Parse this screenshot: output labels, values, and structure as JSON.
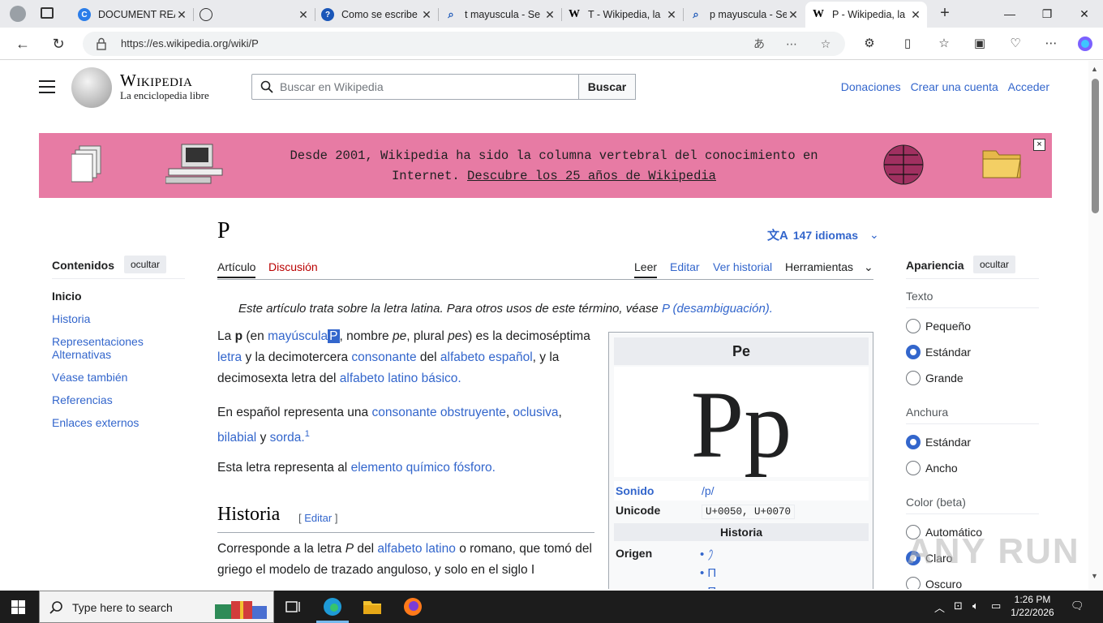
{
  "browser": {
    "tabs": [
      {
        "title": "DOCUMENT READ",
        "icon": "copilot-icon"
      },
      {
        "title": "",
        "icon": "globe-icon"
      },
      {
        "title": "Como se escribe",
        "icon": "question-icon"
      },
      {
        "title": "t mayuscula - Se",
        "icon": "search-icon"
      },
      {
        "title": "T - Wikipedia, la",
        "icon": "wikipedia-icon"
      },
      {
        "title": "p mayuscula - Se",
        "icon": "search-icon"
      },
      {
        "title": "P - Wikipedia, la",
        "icon": "wikipedia-icon"
      }
    ],
    "new_tab": "+",
    "url": "https://es.wikipedia.org/wiki/P"
  },
  "header": {
    "wordmark": "Wikipedia",
    "tagline": "La enciclopedia libre",
    "search_placeholder": "Buscar en Wikipedia",
    "search_button": "Buscar",
    "links": [
      "Donaciones",
      "Crear una cuenta",
      "Acceder"
    ]
  },
  "banner": {
    "line1": "Desde 2001, Wikipedia ha sido la columna vertebral del conocimiento en",
    "line2_prefix": "Internet.",
    "line2_link": "Descubre los 25 años de Wikipedia",
    "close": "×"
  },
  "toc": {
    "title": "Contenidos",
    "hide": "ocultar",
    "items": [
      "Inicio",
      "Historia",
      "Representaciones Alternativas",
      "Véase también",
      "Referencias",
      "Enlaces externos"
    ]
  },
  "article": {
    "title": "P",
    "languages": "147 idiomas",
    "tabs": {
      "article": "Artículo",
      "talk": "Discusión",
      "read": "Leer",
      "edit": "Editar",
      "history": "Ver historial",
      "tools": "Herramientas"
    },
    "hatnote_text": "Este artículo trata sobre la letra latina. Para otros usos de este término, véase",
    "hatnote_link": "P (desambiguación).",
    "p1": {
      "a": "La",
      "b": "p",
      "c": "(en",
      "d": "mayúscula",
      "e": "P",
      "f": ", nombre",
      "g": "pe",
      "h": ", plural",
      "i": "pes",
      "j": ") es la decimoséptima",
      "k": "letra",
      "l": "y la decimotercera",
      "m": "consonante",
      "n": "del",
      "o": "alfabeto español",
      "p": ", y la decimosexta letra del",
      "q": "alfabeto latino básico."
    },
    "p2": {
      "a": "En español representa una",
      "b": "consonante obstruyente",
      "c": ",",
      "d": "oclusiva",
      "e": ",",
      "f": "bilabial",
      "g": "y",
      "h": "sorda.",
      "sup": "1"
    },
    "p3": {
      "a": "Esta letra representa al",
      "b": "elemento químico fósforo."
    },
    "h2": "Historia",
    "h2_edit": "[ editar ]",
    "p4": {
      "a": "Corresponde a la letra",
      "b": "P",
      "c": "del",
      "d": "alfabeto latino",
      "e": "o romano, que tomó del griego el modelo de trazado anguloso, y solo en el siglo I"
    }
  },
  "infobox": {
    "title": "Pe",
    "glyph": "Pp",
    "rows": [
      {
        "key": "Sonido",
        "value": "/p/"
      },
      {
        "key": "Unicode",
        "value": "U+0050, U+0070"
      }
    ],
    "section": "Historia",
    "origin_label": "Origen",
    "origin": [
      "𐤐",
      "Π",
      "Π"
    ]
  },
  "appearance": {
    "title": "Apariencia",
    "hide": "ocultar",
    "text_label": "Texto",
    "text_options": [
      {
        "label": "Pequeño",
        "checked": false
      },
      {
        "label": "Estándar",
        "checked": true
      },
      {
        "label": "Grande",
        "checked": false
      }
    ],
    "width_label": "Anchura",
    "width_options": [
      {
        "label": "Estándar",
        "checked": true
      },
      {
        "label": "Ancho",
        "checked": false
      }
    ],
    "color_label": "Color (beta)",
    "color_options": [
      {
        "label": "Automático",
        "checked": false
      },
      {
        "label": "Claro",
        "checked": true
      },
      {
        "label": "Oscuro",
        "checked": false
      }
    ]
  },
  "watermark": "ANY RUN",
  "taskbar": {
    "search_text": "Type here to search",
    "time": "1:26 PM",
    "date": "1/22/2026"
  },
  "colors": {
    "link": "#3366cc",
    "banner": "#e77ba4",
    "redlink": "#ba0000",
    "taskbar": "#1c1c1c"
  }
}
